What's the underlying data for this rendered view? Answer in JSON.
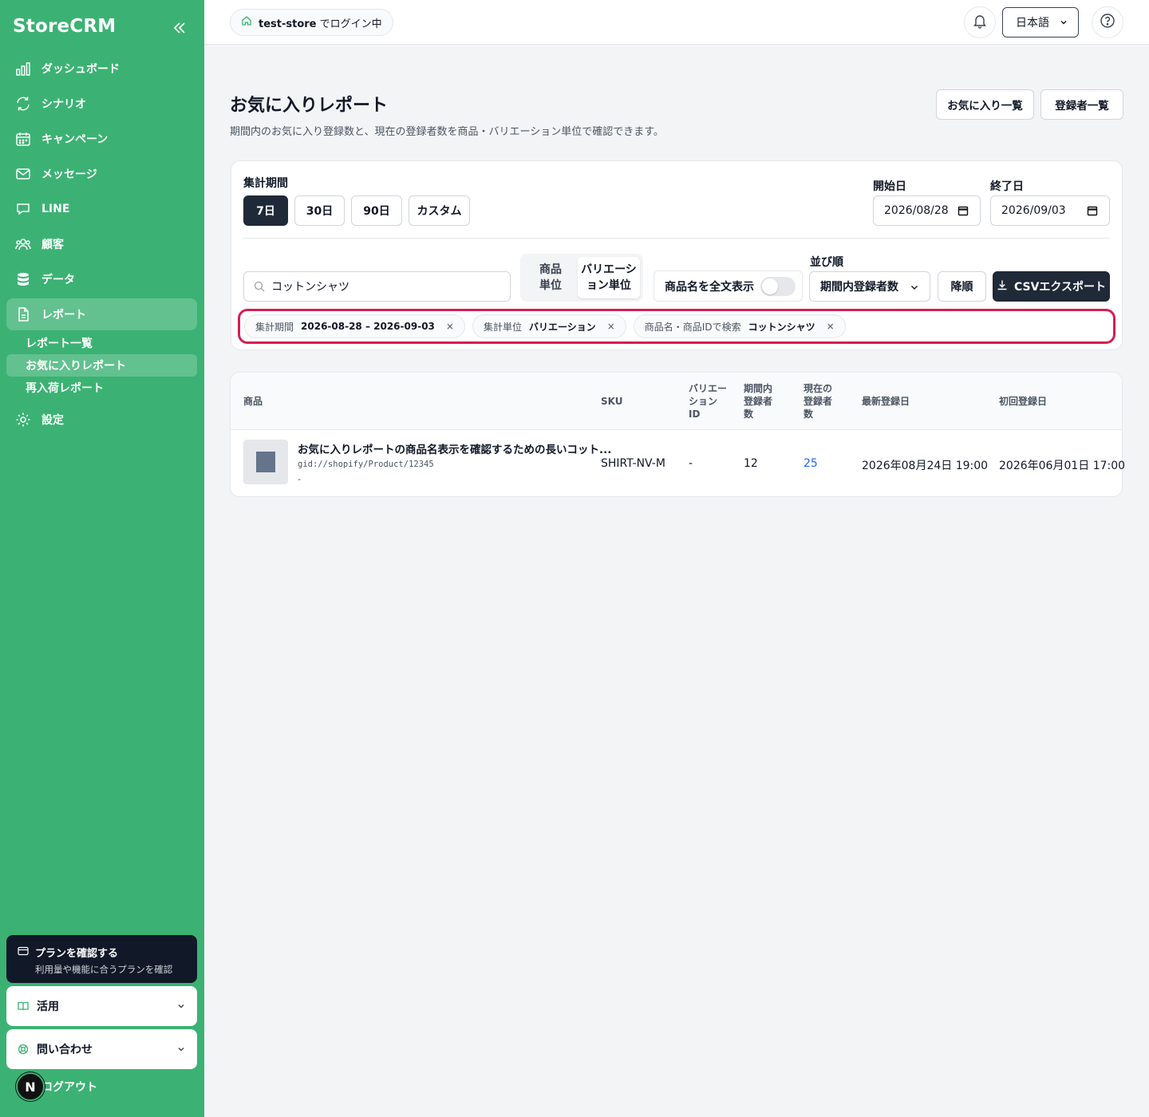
{
  "sidebar": {
    "brand": "StoreCRM",
    "items": [
      {
        "label": "ダッシュボード",
        "icon": "bar-chart-icon"
      },
      {
        "label": "シナリオ",
        "icon": "refresh-icon"
      },
      {
        "label": "キャンペーン",
        "icon": "calendar-icon"
      },
      {
        "label": "メッセージ",
        "icon": "mail-icon"
      },
      {
        "label": "LINE",
        "icon": "chat-icon"
      },
      {
        "label": "顧客",
        "icon": "users-icon"
      },
      {
        "label": "データ",
        "icon": "database-icon"
      },
      {
        "label": "レポート",
        "icon": "file-icon"
      },
      {
        "label": "設定",
        "icon": "gear-icon"
      }
    ],
    "report_sub": [
      "レポート一覧",
      "お気に入りレポート",
      "再入荷レポート"
    ],
    "plan": {
      "title": "プランを確認する",
      "subtitle": "利用量や機能に合うプランを確認"
    },
    "usage": "活用",
    "contact": "問い合わせ",
    "logout": "ログアウト",
    "avatar": "N"
  },
  "topbar": {
    "store": "test-store",
    "store_suffix": "でログイン中",
    "language": "日本語"
  },
  "header": {
    "title": "お気に入りレポート",
    "description": "期間内のお気に入り登録数と、現在の登録者数を商品・バリエーション単位で確認できます。",
    "btn_favorites": "お気に入り一覧",
    "btn_subscribers": "登録者一覧"
  },
  "filters": {
    "period_label": "集計期間",
    "periods": [
      "7日",
      "30日",
      "90日",
      "カスタム"
    ],
    "active_period": "7日",
    "start_label": "開始日",
    "start_value": "2026/08/28",
    "end_label": "終了日",
    "end_value": "2026/09/03",
    "search_value": "コットンシャツ",
    "unit_product": "商品単位",
    "unit_variation": "バリエーション単位",
    "unit_product_l1": "商品",
    "unit_product_l2": "単位",
    "unit_variation_l1": "バリエーシ",
    "unit_variation_l2": "ョン単位",
    "fullname_label": "商品名を全文表示",
    "fullname_on": false,
    "sort_label": "並び順",
    "sort_value": "期間内登録者数",
    "order": "降順",
    "csv": "CSVエクスポート",
    "chips": [
      {
        "key": "集計期間",
        "value": "2026-08-28 – 2026-09-03"
      },
      {
        "key": "集計単位",
        "value": "バリエーション"
      },
      {
        "key": "商品名・商品IDで検索",
        "value": "コットンシャツ"
      }
    ]
  },
  "table": {
    "headers": {
      "product": "商品",
      "sku": "SKU",
      "variation_id": [
        "バリエー",
        "ション",
        "ID"
      ],
      "period_count": [
        "期間内",
        "登録者",
        "数"
      ],
      "current_count": [
        "現在の",
        "登録者",
        "数"
      ],
      "latest": "最新登録日",
      "first": "初回登録日"
    },
    "rows": [
      {
        "name": "お気に入りレポートの商品名表示を確認するための長いコット...",
        "gid": "gid://shopify/Product/12345",
        "variant": "-",
        "sku": "SHIRT-NV-M",
        "variation_id": "-",
        "period_count": "12",
        "current_count": "25",
        "latest": "2026年08月24日 19:00",
        "first": "2026年06月01日 17:00"
      }
    ]
  },
  "colors": {
    "sidebar": "#3bb273",
    "dark": "#1f2937",
    "highlight": "#d41f4f",
    "link": "#2563eb"
  }
}
